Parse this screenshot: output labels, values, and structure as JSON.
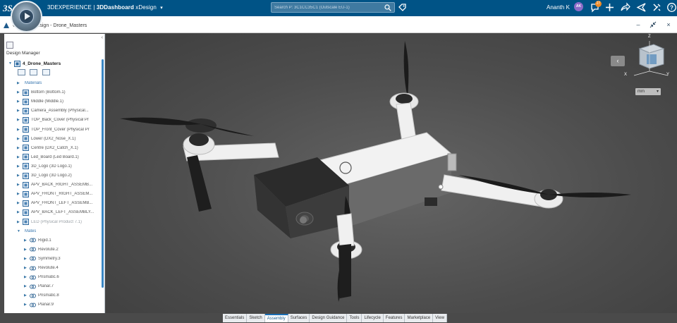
{
  "topbar": {
    "logo": "3S",
    "brand_prefix": "3DEXPERIENCE",
    "brand_app": "3DDashboard",
    "brand_context": "xDesign",
    "search_placeholder": "Search P: 3C1CC35C1 (Outscale EU-1)",
    "user_name": "Ananth K",
    "user_initials": "AK",
    "notifications": "27",
    "icons": [
      "tag-icon",
      "notification-icon",
      "plus-icon",
      "share-icon",
      "send-icon",
      "tools-icon",
      "help-icon"
    ]
  },
  "subbar": {
    "window_title": "CATIA - xDesign - Drone_Masters",
    "controls": [
      "minimize-icon",
      "collapse-icon",
      "close-icon"
    ]
  },
  "panel": {
    "title": "Design Manager",
    "collapse": "‹",
    "root": "4_Drone_Masters",
    "items": [
      {
        "label": "Materials",
        "style": "blue",
        "level": 1,
        "icon": "folder"
      },
      {
        "label": "Bottom (Bottom.1)",
        "style": "",
        "level": 1,
        "icon": "part"
      },
      {
        "label": "Middle (Middle.1)",
        "style": "",
        "level": 1,
        "icon": "part"
      },
      {
        "label": "Camera_Assembly (Physical...",
        "style": "",
        "level": 1,
        "icon": "part"
      },
      {
        "label": "TOP_Back_Cover (Physical Pr",
        "style": "",
        "level": 1,
        "icon": "part"
      },
      {
        "label": "TOP_Front_Cover (Physical Pr",
        "style": "",
        "level": 1,
        "icon": "part"
      },
      {
        "label": "Lower (DX2_Nose_X.1)",
        "style": "",
        "level": 1,
        "icon": "part"
      },
      {
        "label": "Centre (DX2_Catch_X.1)",
        "style": "",
        "level": 1,
        "icon": "part"
      },
      {
        "label": "Led_Board (Led Board.1)",
        "style": "",
        "level": 1,
        "icon": "part"
      },
      {
        "label": "3D_Logo (3D Logo.1)",
        "style": "",
        "level": 1,
        "icon": "part"
      },
      {
        "label": "3D_Logo (3D Logo.2)",
        "style": "",
        "level": 1,
        "icon": "part"
      },
      {
        "label": "APV_BACK_RIGHT_ASSEMB...",
        "style": "",
        "level": 1,
        "icon": "part"
      },
      {
        "label": "APV_FRONT_RIGHT_ASSEM...",
        "style": "",
        "level": 1,
        "icon": "part"
      },
      {
        "label": "APV_FRONT_LEFT_ASSEMB...",
        "style": "",
        "level": 1,
        "icon": "part"
      },
      {
        "label": "APV_BACK_LEFT_ASSEMBLY...",
        "style": "",
        "level": 1,
        "icon": "part"
      },
      {
        "label": "LED (Physical Product 7.1)",
        "style": "grey",
        "level": 1,
        "icon": "part"
      },
      {
        "label": "Mates",
        "style": "blue",
        "level": 1,
        "icon": "folder"
      },
      {
        "label": "Rigid.1",
        "style": "",
        "level": 2,
        "icon": "mate"
      },
      {
        "label": "Revolute.2",
        "style": "",
        "level": 2,
        "icon": "mate"
      },
      {
        "label": "Symmetry.3",
        "style": "",
        "level": 2,
        "icon": "mate"
      },
      {
        "label": "Revolute.4",
        "style": "",
        "level": 2,
        "icon": "mate"
      },
      {
        "label": "Prismatic.6",
        "style": "",
        "level": 2,
        "icon": "mate"
      },
      {
        "label": "Planar.7",
        "style": "",
        "level": 2,
        "icon": "mate"
      },
      {
        "label": "Prismatic.8",
        "style": "",
        "level": 2,
        "icon": "mate"
      },
      {
        "label": "Planar.9",
        "style": "",
        "level": 2,
        "icon": "mate"
      }
    ]
  },
  "viewport": {
    "view_dropdown": "mm",
    "axis_x": "X",
    "axis_y": "Y",
    "axis_z": "Z"
  },
  "actionbar": {
    "tabs": [
      "Essentials",
      "Sketch",
      "Assembly",
      "Surfaces",
      "Design Guidance",
      "Tools",
      "Lifecycle",
      "Features",
      "Marketplace",
      "View"
    ],
    "active": "Assembly"
  },
  "colors": {
    "topbar": "#005386",
    "accent": "#1b6fb5",
    "viewport_bg": "#555555"
  }
}
